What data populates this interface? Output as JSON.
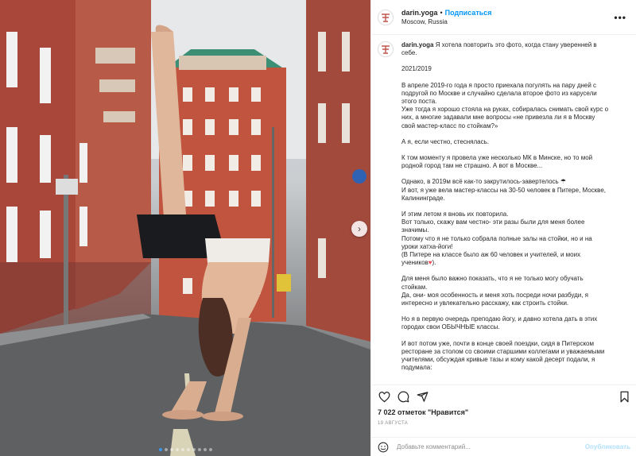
{
  "post": {
    "username": "darin.yoga",
    "separator": "•",
    "follow_label": "Подписаться",
    "location": "Moscow, Russia",
    "more_icon": "more-horizontal-icon"
  },
  "caption": {
    "username": "darin.yoga",
    "lead": "Я хотела повторить это фото, когда стану уверенней в себе.",
    "paragraphs": [
      "2021/2019",
      "В апреле 2019-го года я просто приехала погулять на пару дней с подругой по Москве и случайно сделала второе фото из карусели этого поста.\nУже тогда я хорошо стояла на руках, собиралась снимать свой курс о них, а многие задавали мне вопросы «не привезла ли я в Москву свой мастер-класс по стойкам?»",
      "А я, если честно, стеснялась.",
      "К том моменту я провела уже несколько МК в Минске, но то мой родной город там не страшно. А вот в Москве...",
      "Однако, в 2019м всё как-то закрутилось-завертелось ☂\nИ вот, я уже вела мастер-классы на 30-50 человек в Питере, Москве, Калининграде.",
      "И этим летом я вновь их повторила.\nВот только, скажу вам честно- эти разы были для меня более значимы.\nПотому что я не только собрала полные залы на стойки, но и на уроки хатха-йоги!\n(В Питере на классе было аж 60 человек и учителей, и моих учеников",
      "Для меня было важно показать, что я не только могу обучать стойкам.\nДа, они- моя особенность и меня хоть посреди ночи разбуди, я интересно и увлекательно расскажу, как строить стойки.",
      "Но я в первую очередь преподаю йогу, и давно хотела дать в этих городах свои ОБЫЧНЫЕ классы.",
      "И вот потом уже, почти в конце своей поездки, сидя в Питерском ресторане за столом со своими старшими коллегами и уважаемыми учителями, обсуждая кривые тазы и кому какой десерт подали, я подумала:"
    ],
    "heart_suffix": "♥",
    "close_paren": ")."
  },
  "actions": {
    "like_icon": "heart-icon",
    "comment_icon": "comment-icon",
    "share_icon": "share-icon",
    "save_icon": "bookmark-icon"
  },
  "likes_text": "7 022 отметок \"Нравится\"",
  "date_text": "19 АВГУСТА",
  "comment_box": {
    "emoji_icon": "emoji-icon",
    "placeholder": "Добавьте комментарий...",
    "publish_label": "Опубликовать"
  },
  "carousel": {
    "dot_count": 10,
    "active_index": 0,
    "next_icon": "chevron-right-icon"
  }
}
